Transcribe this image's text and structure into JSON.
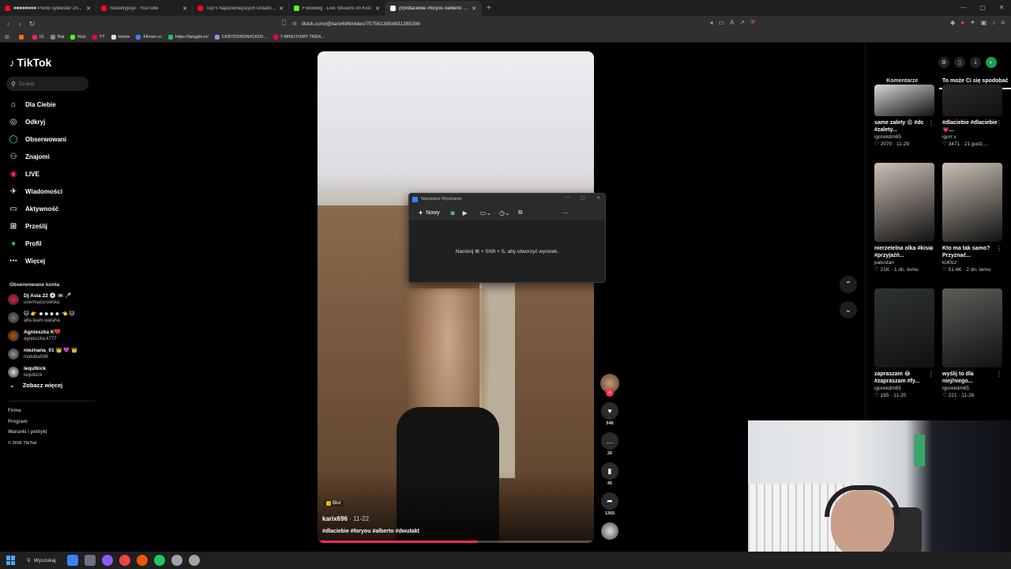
{
  "browser": {
    "tabs": [
      {
        "label": "■■■■■■■■ Plocki sylwester 20...",
        "color": "#ff0033",
        "active": false
      },
      {
        "label": "Subskrypcje - YouTube",
        "color": "#ff0033",
        "active": false
      },
      {
        "label": "Top 5 Najdziwniejszych Ostatnich Fi...",
        "color": "#ff0033",
        "active": false
      },
      {
        "label": "Following - Live Streams on Kick",
        "color": "#53fc18",
        "active": false
      },
      {
        "label": "(9)#dlaciebie #foryou #alberto #...",
        "color": "#ffffff",
        "active": true
      }
    ],
    "url": "tiktok.com/@karix696/video/7575613854831365398",
    "bookmarks": [
      {
        "label": "",
        "color": "#f97316"
      },
      {
        "label": "IG",
        "color": "#d62976"
      },
      {
        "label": "Rat",
        "color": "#888888"
      },
      {
        "label": "Kick",
        "color": "#53fc18"
      },
      {
        "label": "YT",
        "color": "#ff0033"
      },
      {
        "label": "Home",
        "color": "#dddddd"
      },
      {
        "label": "Filman.cc",
        "color": "#3b82f6"
      },
      {
        "label": "https://tanggle.io/",
        "color": "#22c55e"
      },
      {
        "label": "CKBTDDRDN#CKD0...",
        "color": "#a78bfa"
      },
      {
        "label": "7-MINUTOWY TREN...",
        "color": "#ff0033"
      }
    ]
  },
  "tiktok": {
    "logo": "TikTok",
    "search_placeholder": "Szukaj",
    "nav": [
      {
        "label": "Dla Ciebie",
        "icon": "home-icon",
        "glyph": "⌂"
      },
      {
        "label": "Odkryj",
        "icon": "compass-icon",
        "glyph": "◎"
      },
      {
        "label": "Obserwowani",
        "icon": "following-icon",
        "glyph": "◯"
      },
      {
        "label": "Znajomi",
        "icon": "friends-icon",
        "glyph": "⚇"
      },
      {
        "label": "LIVE",
        "icon": "live-icon",
        "glyph": "◉"
      },
      {
        "label": "Wiadomości",
        "icon": "messages-icon",
        "glyph": "✈"
      },
      {
        "label": "Aktywność",
        "icon": "activity-icon",
        "glyph": "▭"
      },
      {
        "label": "Prześlij",
        "icon": "upload-icon",
        "glyph": "⊞"
      },
      {
        "label": "Profil",
        "icon": "profile-icon",
        "glyph": "●"
      },
      {
        "label": "Więcej",
        "icon": "more-icon",
        "glyph": "⋯"
      }
    ],
    "followed_title": "Obserwowane konta",
    "accounts": [
      {
        "name": "Dj Asia 22 💿 📼 🎤",
        "handle": "usermazurowska",
        "color": "#e11d48"
      },
      {
        "name": "🐱 👉 ☻☻☻☻ 👈 🐱",
        "handle": "alfa.team.wataha",
        "color": "#777777"
      },
      {
        "name": "Agnieszka K💔",
        "handle": "agnieszka.k777",
        "color": "#b45309"
      },
      {
        "name": "nieznana_01 👑 💜 👑",
        "handle": "malutka596",
        "color": "#999999"
      },
      {
        "name": "lequtkick",
        "handle": "lequtkick",
        "color": "#dddddd"
      }
    ],
    "see_more": "Zobacz więcej",
    "footer": [
      "Firma",
      "Program",
      "Warunki i polityki",
      "© 2025 TikTok"
    ]
  },
  "video": {
    "badge": "Blur",
    "author": "karix696",
    "date": "11-22",
    "tags": "#dlaciebie #foryou #alberto #dwutakt",
    "progress": 0.58,
    "likes": "548",
    "comments": "26",
    "saves": "45",
    "shares": "1365"
  },
  "snipping": {
    "title": "Narzędzie Wycinanie",
    "new_label": "Nowy",
    "hint": "Naciśnij ⊞ + Shift + S, aby utworzyć wycinek."
  },
  "rightpanel": {
    "tabs": [
      "Komentarze",
      "To może Ci się spodobać"
    ],
    "cards": [
      {
        "caption": "same zalety 😩 #dc #zalety...",
        "user": "igorekdm65",
        "stats": "♡ 2070 · 11-29",
        "tint": "#d9d7d3"
      },
      {
        "caption": "#dlaciebie #dlaciebie 💗...",
        "user": "igorr.v",
        "stats": "♡ 3471 · 21 godz....",
        "tint": "#2a2a2a"
      },
      {
        "caption": "nierzetelna olka #kisio #przyjaźń...",
        "user": "patostan",
        "stats": "♡ 21K · 1 dn. temu",
        "tint": "#cdbfb6"
      },
      {
        "caption": "Kto ma tak samo? Przyznać...",
        "user": "kol0cz",
        "stats": "♡ 51.4K · 2 dn. temu",
        "tint": "#c9c0b3"
      },
      {
        "caption": "zapraszam 😂 #zapraszam #fy...",
        "user": "igorekdm65",
        "stats": "♡ 185 · 11-20",
        "tint": "#2f3430"
      },
      {
        "caption": "wyślij to dla niej/niego...",
        "user": "igorekdm65",
        "stats": "♡ 221 · 11-26",
        "tint": "#5a5e58"
      }
    ]
  },
  "taskbar": {
    "search_label": "Wyszukaj",
    "apps": [
      "#3b82f6",
      "#6b7280",
      "#8b5cf6",
      "#ef4444",
      "#ea580c",
      "#22c55e",
      "#9ca3af",
      "#a3a3a3"
    ]
  }
}
